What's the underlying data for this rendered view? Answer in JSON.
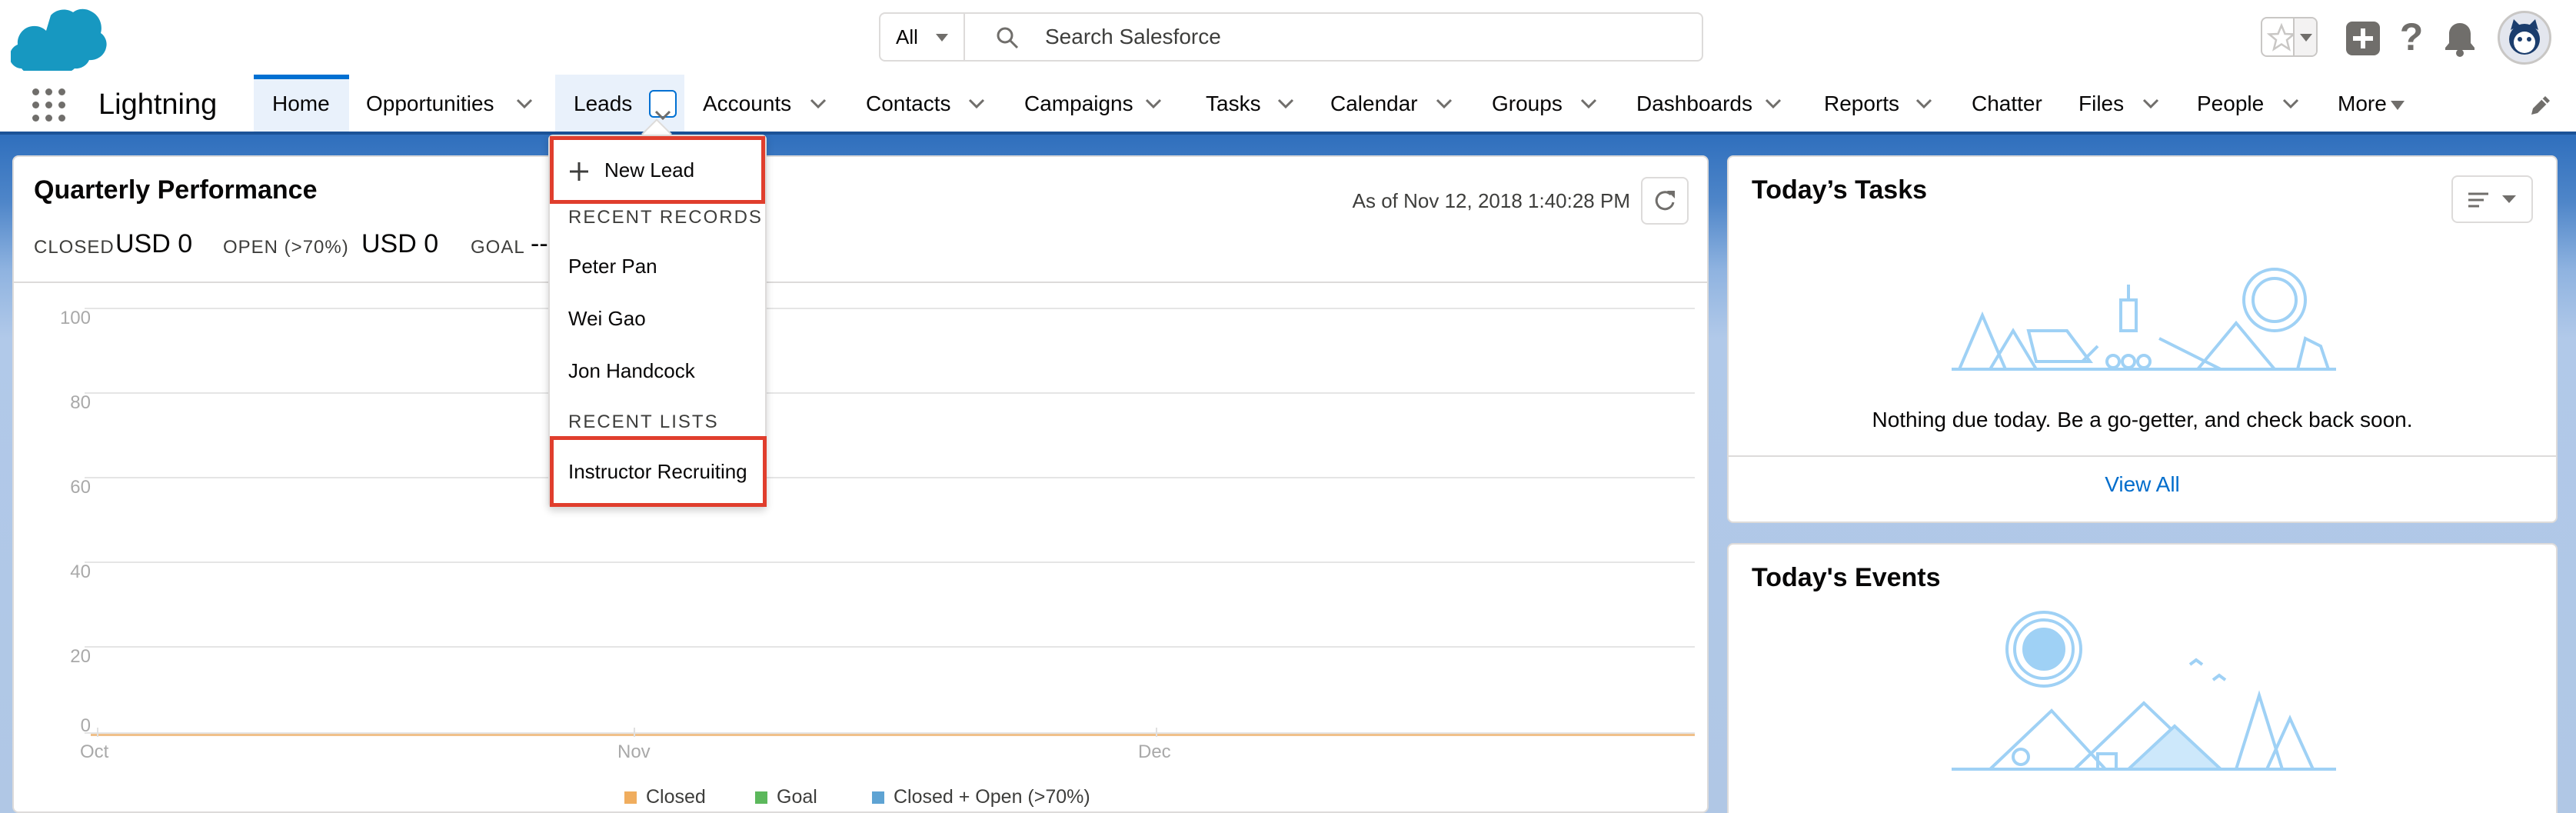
{
  "header": {
    "search_scope": "All",
    "search_placeholder": "Search Salesforce",
    "help_glyph": "?"
  },
  "nav": {
    "app_name": "Lightning",
    "tabs": [
      {
        "label": "Home"
      },
      {
        "label": "Opportunities"
      },
      {
        "label": "Leads"
      },
      {
        "label": "Accounts"
      },
      {
        "label": "Contacts"
      },
      {
        "label": "Campaigns"
      },
      {
        "label": "Tasks"
      },
      {
        "label": "Calendar"
      },
      {
        "label": "Groups"
      },
      {
        "label": "Dashboards"
      },
      {
        "label": "Reports"
      },
      {
        "label": "Chatter"
      },
      {
        "label": "Files"
      },
      {
        "label": "People"
      },
      {
        "label": "More"
      }
    ]
  },
  "leads_menu": {
    "new_label": "New Lead",
    "recent_records_heading": "RECENT RECORDS",
    "recent_records": [
      "Peter Pan",
      "Wei Gao",
      "Jon Handcock"
    ],
    "recent_lists_heading": "RECENT LISTS",
    "recent_lists": [
      "Instructor Recruiting"
    ]
  },
  "performance": {
    "title": "Quarterly Performance",
    "as_of": "As of Nov 12, 2018 1:40:28 PM",
    "closed_label": "CLOSED",
    "closed_value": "USD 0",
    "open_label": "OPEN (>70%)",
    "open_value": "USD 0",
    "goal_label": "GOAL",
    "goal_value": "--"
  },
  "chart_data": {
    "type": "line",
    "x": [
      "Oct",
      "Nov",
      "Dec"
    ],
    "ylim": [
      0,
      100
    ],
    "yticks": [
      "100",
      "80",
      "60",
      "40",
      "20",
      "0"
    ],
    "series": [
      {
        "name": "Closed",
        "values": [
          0,
          0,
          0
        ],
        "color": "#f0ad5e"
      },
      {
        "name": "Goal",
        "values": [],
        "color": "#5cb85c"
      },
      {
        "name": "Closed + Open (>70%)",
        "values": [],
        "color": "#5ea3d3"
      }
    ],
    "grid": true,
    "legend": "bottom"
  },
  "tasks": {
    "title": "Today’s Tasks",
    "empty_message": "Nothing due today. Be a go-getter, and check back soon.",
    "view_all": "View All"
  },
  "events": {
    "title": "Today's Events"
  },
  "colors": {
    "accent": "#0070d2",
    "highlight_box": "#e03e2d",
    "brand_cloud": "#1798c1"
  },
  "icons": [
    "salesforce-logo",
    "search-icon",
    "star-icon",
    "plus-icon",
    "help-icon",
    "bell-icon",
    "avatar-icon",
    "waffle-icon",
    "chevron-down-icon",
    "pencil-icon",
    "refresh-icon",
    "sort-icon"
  ]
}
